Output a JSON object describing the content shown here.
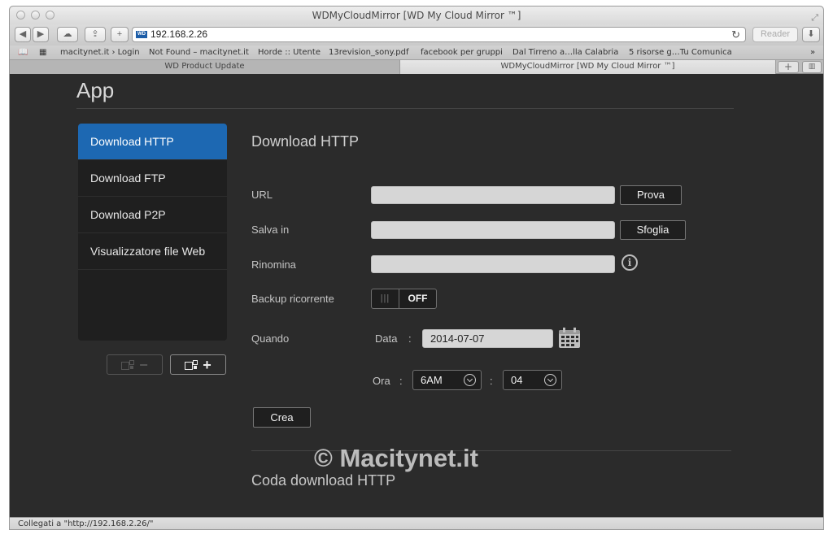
{
  "window": {
    "title": "WDMyCloudMirror [WD My Cloud Mirror ™]"
  },
  "toolbar": {
    "url": "192.168.2.26",
    "reader_label": "Reader",
    "favicon_label": "WD",
    "icons": [
      "back-icon",
      "forward-icon",
      "cloud-icon",
      "share-icon",
      "add-icon",
      "reload-icon",
      "download-icon"
    ]
  },
  "bookmarks": [
    "macitynet.it › Login",
    "Not Found – macitynet.it",
    "Horde :: Utente",
    "13revision_sony.pdf",
    "facebook per gruppi",
    "Dal Tirreno a…lla Calabria",
    "5 risorse g…Tu Comunica"
  ],
  "tabs": [
    {
      "label": "WD Product Update",
      "active": false
    },
    {
      "label": "WDMyCloudMirror [WD My Cloud Mirror ™]",
      "active": true
    }
  ],
  "app": {
    "title": "App",
    "menu": [
      {
        "label": "Download HTTP",
        "active": true
      },
      {
        "label": "Download FTP",
        "active": false
      },
      {
        "label": "Download P2P",
        "active": false
      },
      {
        "label": "Visualizzatore file Web",
        "active": false
      }
    ]
  },
  "form": {
    "title": "Download HTTP",
    "url_label": "URL",
    "url_value": "",
    "test_button": "Prova",
    "save_label": "Salva in",
    "save_value": "",
    "browse_button": "Sfoglia",
    "rename_label": "Rinomina",
    "rename_value": "",
    "backup_label": "Backup ricorrente",
    "backup_grip": "|||",
    "backup_state": "OFF",
    "when_label": "Quando",
    "date_label": "Data",
    "date_sep": ":",
    "date_value": "2014-07-07",
    "time_label": "Ora",
    "time_sep": ":",
    "time_sep2": ":",
    "hour_value": "6AM",
    "minute_value": "04",
    "create_button": "Crea"
  },
  "queue": {
    "title": "Coda download HTTP"
  },
  "watermark": "© Macitynet.it",
  "status": "Collegati a \"http://192.168.2.26/\"",
  "colors": {
    "accent": "#1d68b2",
    "background": "#2b2b2b",
    "menu_bg": "#1f1f1f"
  }
}
